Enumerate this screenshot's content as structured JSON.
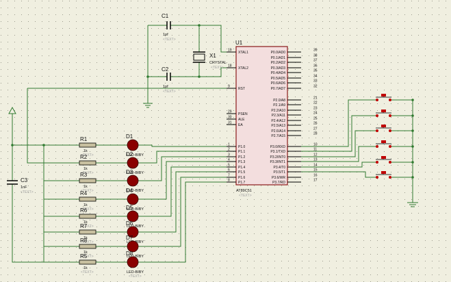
{
  "colors": {
    "background": "#f0efe0",
    "grid_dot": "#9a9a8c",
    "wire": "#2f7a2f",
    "chip_fill": "#f3dede",
    "chip_border": "#8a1a1a",
    "led": "#8a0000",
    "resistor": "#c8c0a0",
    "switch_dot": "#c00000",
    "text": "#101010",
    "text_placeholder": "#a0a0a0"
  },
  "chip": {
    "ref": "U1",
    "part": "AT89C51",
    "text_placeholder": "<TEXT>",
    "left_pins": [
      {
        "num": "19",
        "name": "XTAL1"
      },
      {
        "num": "18",
        "name": "XTAL2"
      },
      {
        "num": "9",
        "name": "RST"
      },
      {
        "num": "29",
        "name": "PSEN"
      },
      {
        "num": "30",
        "name": "ALE"
      },
      {
        "num": "31",
        "name": "EA"
      },
      {
        "num": "1",
        "name": "P1.0"
      },
      {
        "num": "2",
        "name": "P1.1"
      },
      {
        "num": "3",
        "name": "P1.2"
      },
      {
        "num": "4",
        "name": "P1.3"
      },
      {
        "num": "5",
        "name": "P1.4"
      },
      {
        "num": "6",
        "name": "P1.5"
      },
      {
        "num": "7",
        "name": "P1.6"
      },
      {
        "num": "8",
        "name": "P1.7"
      }
    ],
    "right_pins": [
      {
        "num": "39",
        "name": "P0.0/AD0"
      },
      {
        "num": "38",
        "name": "P0.1/AD1"
      },
      {
        "num": "37",
        "name": "P0.2/AD2"
      },
      {
        "num": "36",
        "name": "P0.3/AD3"
      },
      {
        "num": "35",
        "name": "P0.4/AD4"
      },
      {
        "num": "34",
        "name": "P0.5/AD5"
      },
      {
        "num": "33",
        "name": "P0.6/AD6"
      },
      {
        "num": "32",
        "name": "P0.7/AD7"
      },
      {
        "num": "21",
        "name": "P2.0/A8"
      },
      {
        "num": "22",
        "name": "P2.1/A9"
      },
      {
        "num": "23",
        "name": "P2.2/A10"
      },
      {
        "num": "24",
        "name": "P2.3/A11"
      },
      {
        "num": "25",
        "name": "P2.4/A12"
      },
      {
        "num": "26",
        "name": "P2.5/A13"
      },
      {
        "num": "27",
        "name": "P2.6/A14"
      },
      {
        "num": "28",
        "name": "P2.7/A15"
      },
      {
        "num": "10",
        "name": "P3.0/RXD"
      },
      {
        "num": "11",
        "name": "P3.1/TXD"
      },
      {
        "num": "12",
        "name": "P3.2/INT0"
      },
      {
        "num": "13",
        "name": "P3.3/INT1"
      },
      {
        "num": "14",
        "name": "P3.4/T0"
      },
      {
        "num": "15",
        "name": "P3.5/T1"
      },
      {
        "num": "16",
        "name": "P3.6/WR"
      },
      {
        "num": "17",
        "name": "P3.7/RD"
      }
    ]
  },
  "capacitors": {
    "c1": {
      "ref": "C1",
      "value": "1pf",
      "text": "<TEXT>"
    },
    "c2": {
      "ref": "C2",
      "value": "1pf",
      "text": "<TEXT>"
    },
    "c3": {
      "ref": "C3",
      "value": "1nF",
      "text": "<TEXT>"
    }
  },
  "crystal": {
    "ref": "X1",
    "type": "CRYSTAL",
    "text": "<TEXT>"
  },
  "resistors": [
    {
      "ref": "R1",
      "value": "1k",
      "text": "<TEXT>"
    },
    {
      "ref": "R2",
      "value": "1k",
      "text": "<TEXT>"
    },
    {
      "ref": "R3",
      "value": "1k",
      "text": "<TEXT>"
    },
    {
      "ref": "R4",
      "value": "1k",
      "text": "<TEXT>"
    },
    {
      "ref": "R6",
      "value": "1k",
      "text": "<TEXT>"
    },
    {
      "ref": "R7",
      "value": "1k",
      "text": "<TEXT>"
    },
    {
      "ref": "R8",
      "value": "1k",
      "text": "<TEXT>"
    },
    {
      "ref": "R5",
      "value": "1k",
      "text": "<TEXT>"
    }
  ],
  "leds": [
    {
      "ref": "D1",
      "part": "LED-BIBY"
    },
    {
      "ref": "D2",
      "part": "LED-BIBY"
    },
    {
      "ref": "D3",
      "part": "LED-BIBY"
    },
    {
      "ref": "D4",
      "part": "LED-BIBY"
    },
    {
      "ref": "D5",
      "part": "LED-BIBY"
    },
    {
      "ref": "D6",
      "part": "LED-BIBY"
    },
    {
      "ref": "D7",
      "part": "LED-BIBY"
    },
    {
      "ref": "D8",
      "part": "LED-BIBY",
      "text": "<TEXT>"
    }
  ],
  "switch_count": 6
}
